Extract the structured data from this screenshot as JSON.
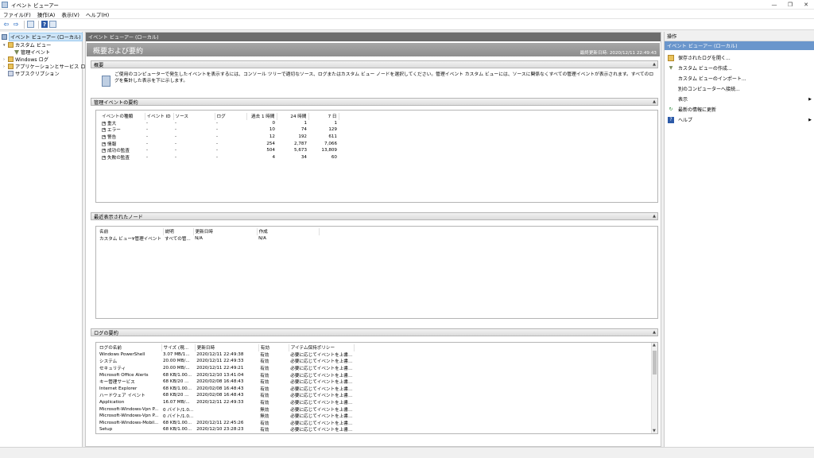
{
  "window": {
    "title": "イベント ビューアー"
  },
  "window_buttons": {
    "minimize": "—",
    "maximize": "❐",
    "close": "✕"
  },
  "menu": [
    "ファイル(F)",
    "操作(A)",
    "表示(V)",
    "ヘルプ(H)"
  ],
  "toolbar": {
    "back": "⇦",
    "forward": "⇨",
    "help": "?"
  },
  "tree": [
    {
      "label": "イベント ビューアー (ローカル)",
      "icon": "computer-icon",
      "selected": true
    },
    {
      "label": "カスタム ビュー",
      "icon": "folder-icon",
      "expander": "▾"
    },
    {
      "label": "管理イベント",
      "icon": "filter-icon"
    },
    {
      "label": "Windows ログ",
      "icon": "folder-icon",
      "expander": "›"
    },
    {
      "label": "アプリケーションとサービス ログ",
      "icon": "folder-icon",
      "expander": "›"
    },
    {
      "label": "サブスクリプション",
      "icon": "subscription-icon"
    }
  ],
  "center": {
    "header": "イベント ビューアー (ローカル)",
    "banner_title": "概要および要約",
    "last_updated": "最終更新日時: 2020/12/11 22:49:43",
    "overview": {
      "title": "概要",
      "text": "ご使用のコンピューターで発生したイベントを表示するには、コンソール ツリーで適切なソース、ログまたはカスタム ビュー ノードを選択してください。管理イベント カスタム ビューには、ソースに関係なくすべての管理イベントが表示されます。すべてのログを集計した表示を下に示します。"
    },
    "admin_summary": {
      "title": "管理イベントの要約",
      "columns": [
        "イベントの種類",
        "イベント ID",
        "ソース",
        "ログ",
        "過去 1 時間",
        "24 時間",
        "7 日"
      ],
      "rows": [
        [
          "重大",
          "-",
          "-",
          "-",
          "0",
          "1",
          "1"
        ],
        [
          "エラー",
          "-",
          "-",
          "-",
          "10",
          "74",
          "129"
        ],
        [
          "警告",
          "-",
          "-",
          "-",
          "12",
          "192",
          "611"
        ],
        [
          "情報",
          "-",
          "-",
          "-",
          "254",
          "2,787",
          "7,066"
        ],
        [
          "成功の監査",
          "-",
          "-",
          "-",
          "504",
          "5,673",
          "13,809"
        ],
        [
          "失敗の監査",
          "-",
          "-",
          "-",
          "4",
          "34",
          "60"
        ]
      ]
    },
    "recent_nodes": {
      "title": "最近表示されたノード",
      "columns": [
        "名前",
        "説明",
        "更新日時",
        "作成"
      ],
      "rows": [
        [
          "カスタム ビュー¥管理イベント",
          "すべての管...",
          "N/A",
          "N/A"
        ]
      ]
    },
    "log_summary": {
      "title": "ログの要約",
      "columns": [
        "ログの名前",
        "サイズ (現...",
        "更新日時",
        "有効",
        "アイテム保持ポリシー"
      ],
      "rows": [
        [
          "Windows PowerShell",
          "3.07 MB/1...",
          "2020/12/11 22:49:38",
          "有効",
          "必要に応じてイベントを上書..."
        ],
        [
          "システム",
          "20.00 MB/...",
          "2020/12/11 22:49:33",
          "有効",
          "必要に応じてイベントを上書..."
        ],
        [
          "セキュリティ",
          "20.00 MB/...",
          "2020/12/11 22:49:21",
          "有効",
          "必要に応じてイベントを上書..."
        ],
        [
          "Microsoft Office Alerts",
          "68 KB/1.00...",
          "2020/12/10 13:41:04",
          "有効",
          "必要に応じてイベントを上書..."
        ],
        [
          "キー管理サービス",
          "68 KB/20 ...",
          "2020/02/08 16:48:43",
          "有効",
          "必要に応じてイベントを上書..."
        ],
        [
          "Internet Explorer",
          "68 KB/1.00...",
          "2020/02/08 16:48:43",
          "有効",
          "必要に応じてイベントを上書..."
        ],
        [
          "ハードウェア イベント",
          "68 KB/20 ...",
          "2020/02/08 16:48:43",
          "有効",
          "必要に応じてイベントを上書..."
        ],
        [
          "Application",
          "16.07 MB/...",
          "2020/12/11 22:49:33",
          "有効",
          "必要に応じてイベントを上書..."
        ],
        [
          "Microsoft-Windows-Vpn P...",
          "0 バイト/1.0...",
          "",
          "無効",
          "必要に応じてイベントを上書..."
        ],
        [
          "Microsoft-Windows-Vpn P...",
          "0 バイト/1.0...",
          "",
          "無効",
          "必要に応じてイベントを上書..."
        ],
        [
          "Microsoft-Windows-Mobil...",
          "68 KB/1.00...",
          "2020/12/11 22:45:26",
          "有効",
          "必要に応じてイベントを上書..."
        ],
        [
          "Setup",
          "68 KB/1.00...",
          "2020/12/10 23:28:23",
          "有効",
          "必要に応じてイベントを上書..."
        ]
      ]
    }
  },
  "actions": {
    "title": "操作",
    "subtitle": "イベント ビューアー (ローカル)",
    "items": [
      {
        "label": "保存されたログを開く...",
        "icon": "open-folder-icon"
      },
      {
        "label": "カスタム ビューの作成...",
        "icon": "filter-icon"
      },
      {
        "label": "カスタム ビューのインポート...",
        "icon": ""
      },
      {
        "label": "別のコンピューターへ接続...",
        "icon": ""
      },
      {
        "label": "表示",
        "icon": "",
        "submenu": "▶"
      },
      {
        "label": "最新の情報に更新",
        "icon": "refresh-icon"
      },
      {
        "label": "ヘルプ",
        "icon": "help-icon",
        "submenu": "▶"
      }
    ]
  },
  "colors": {
    "accent": "#6a96cc",
    "pane_header": "#6d6d6d",
    "banner": "#9a9a9a"
  }
}
